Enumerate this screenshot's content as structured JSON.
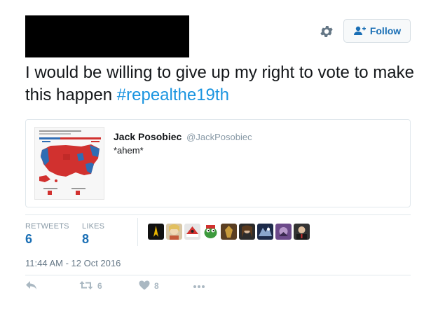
{
  "tweet": {
    "text_main": "I would be willing to give up my right to vote to make this happen ",
    "hashtag": "#repealthe19th",
    "timestamp": "11:44 AM - 12 Oct 2016"
  },
  "header": {
    "follow_label": "Follow",
    "icons": [
      "gear-icon",
      "add-user-icon"
    ]
  },
  "quote": {
    "author_name": "Jack Posobiec",
    "author_handle": "@JackPosobiec",
    "text": "*ahem*"
  },
  "stats": {
    "retweets_label": "RETWEETS",
    "retweets_count": "6",
    "likes_label": "LIKES",
    "likes_count": "8"
  },
  "actions": {
    "retweet_count": "6",
    "like_count": "8",
    "icons": [
      "reply-icon",
      "retweet-icon",
      "heart-icon",
      "more-icon"
    ]
  },
  "colors": {
    "link_blue": "#1b95e0",
    "stat_blue": "#1a6fb5",
    "muted_gray": "#8899a6",
    "map_red": "#d1312f",
    "map_blue": "#2e6db4"
  }
}
